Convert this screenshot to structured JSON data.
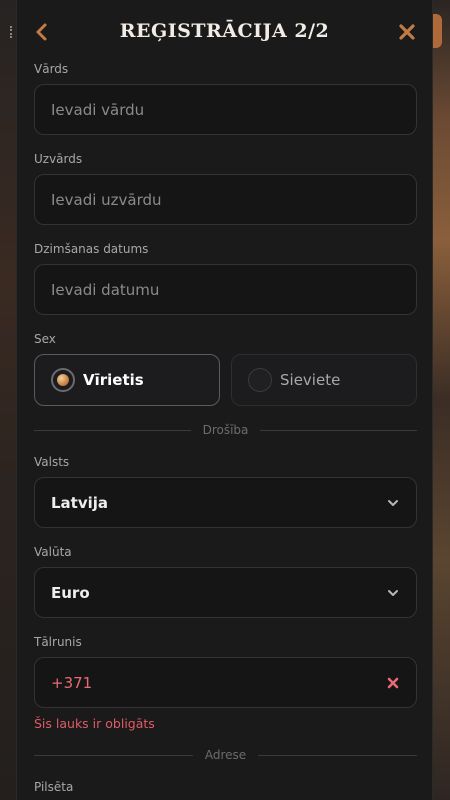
{
  "header": {
    "title": "REĢISTRĀCIJA 2/2",
    "back_icon": "chevron-left-icon",
    "close_icon": "close-icon",
    "accent": "#c47a43"
  },
  "form": {
    "first_name": {
      "label": "Vārds",
      "placeholder": "Ievadi vārdu"
    },
    "last_name": {
      "label": "Uzvārds",
      "placeholder": "Ievadi uzvārdu"
    },
    "birthdate": {
      "label": "Dzimšanas datums",
      "placeholder": "Ievadi datumu"
    },
    "sex": {
      "label": "Sex",
      "options": [
        {
          "label": "Vīrietis",
          "selected": true
        },
        {
          "label": "Sieviete",
          "selected": false
        }
      ]
    },
    "section_security": "Drošība",
    "country": {
      "label": "Valsts",
      "value": "Latvija"
    },
    "currency": {
      "label": "Valūta",
      "value": "Euro"
    },
    "phone": {
      "label": "Tālrunis",
      "value": "+371",
      "error": "Šis lauks ir obligāts",
      "error_color": "#e05a66"
    },
    "section_address": "Adrese",
    "city": {
      "label": "Pilsēta"
    }
  }
}
